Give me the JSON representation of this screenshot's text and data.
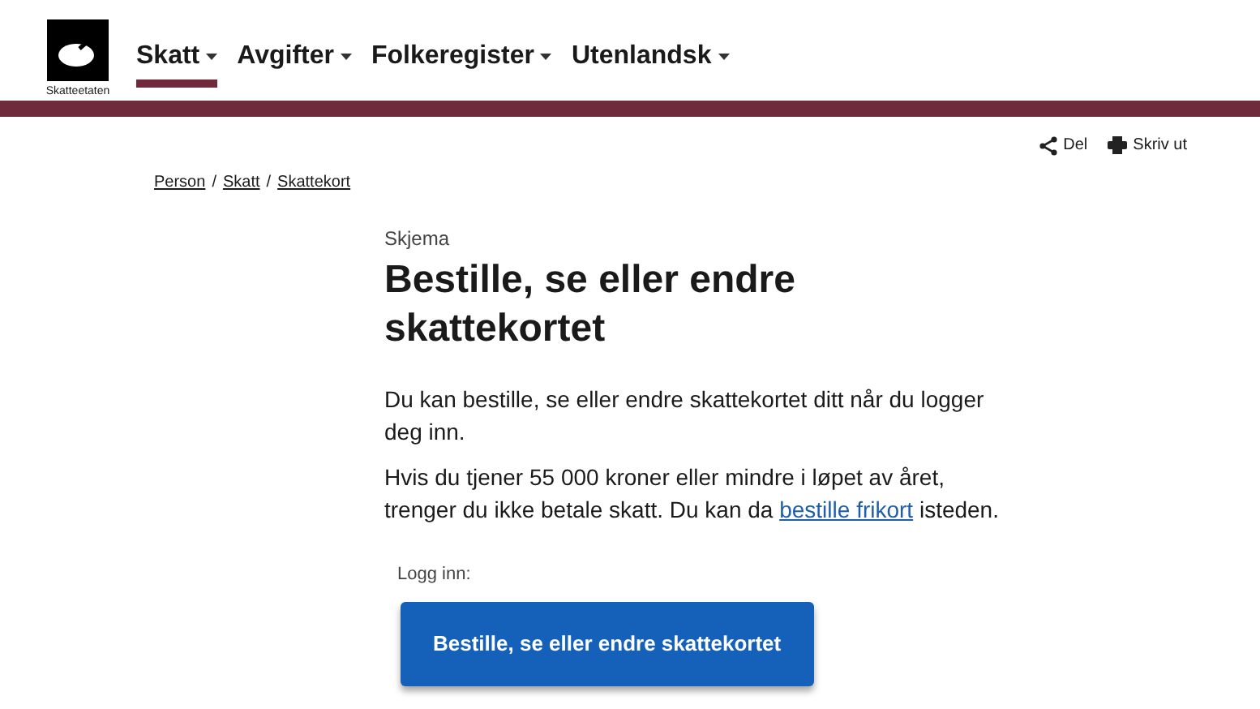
{
  "logo": {
    "label": "Skatteetaten"
  },
  "nav": [
    {
      "label": "Skatt",
      "selected": true
    },
    {
      "label": "Avgifter",
      "selected": false
    },
    {
      "label": "Folkeregister",
      "selected": false
    },
    {
      "label": "Utenlandsk",
      "selected": false
    }
  ],
  "actions": [
    {
      "kind": "share",
      "label": "Del"
    },
    {
      "kind": "print",
      "label": "Skriv ut"
    }
  ],
  "breadcrumb": {
    "separator": "/",
    "items": [
      "Person",
      "Skatt",
      "Skattekort"
    ]
  },
  "eyebrow": "Skjema",
  "title": "Bestille, se eller endre skattekortet",
  "intro": "Du kan bestille, se eller endre skattekortet ditt når du logger deg inn.",
  "info": {
    "before": "Hvis du tjener 55 000 kroner eller mindre i løpet av året, trenger du ikke betale skatt. Du kan da",
    "link": "bestille frikort",
    "after": "isteden."
  },
  "login_label": "Logg inn:",
  "primary_button": "Bestille, se eller endre skattekortet"
}
